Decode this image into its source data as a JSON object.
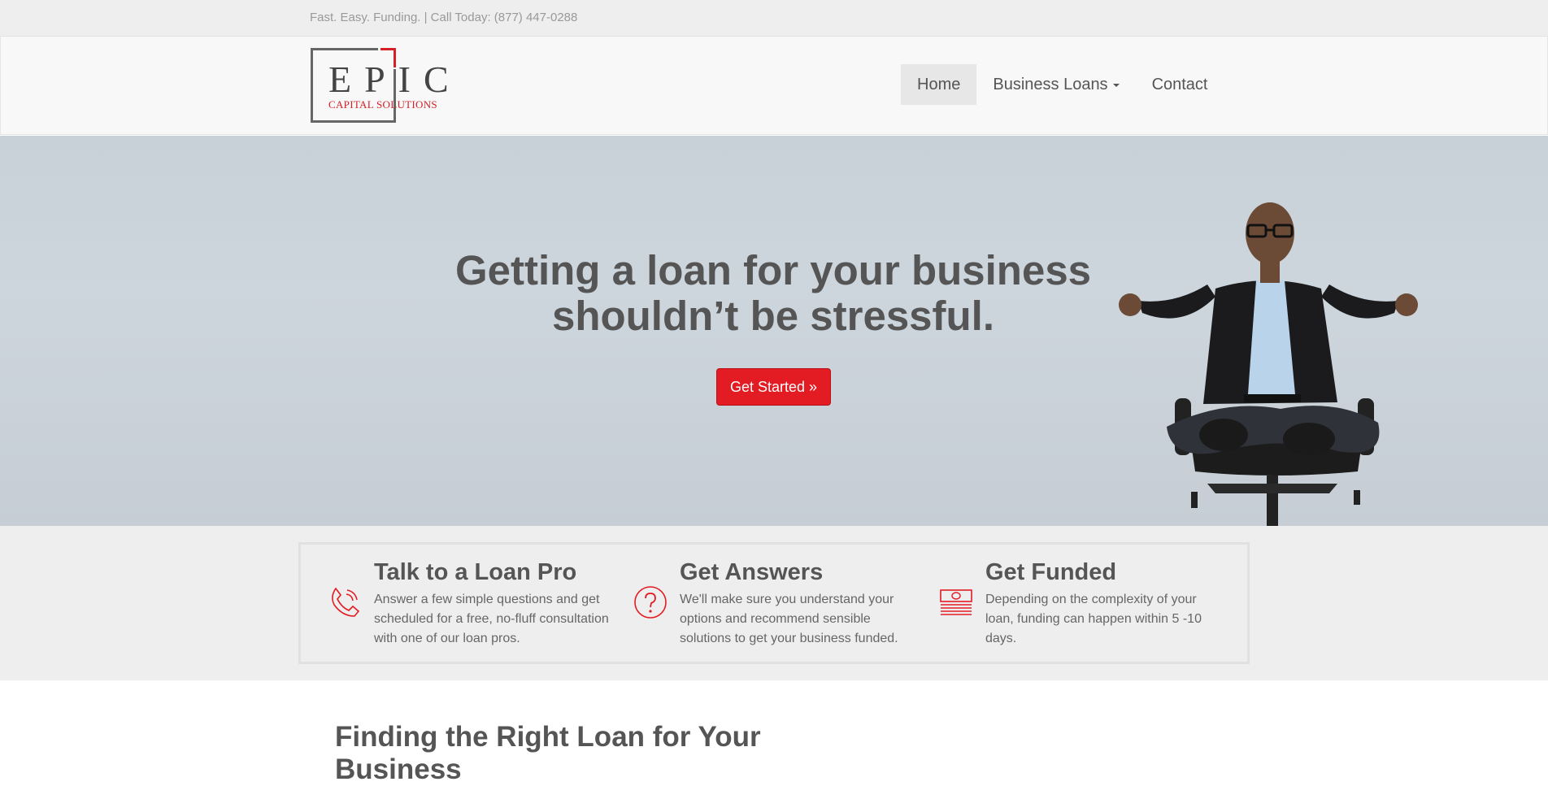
{
  "topbar": {
    "tagline": "Fast. Easy. Funding. | Call Today: (877) 447-0288"
  },
  "logo": {
    "word": "EPIC",
    "sub": "CAPITAL SOLUTIONS"
  },
  "nav": {
    "home": "Home",
    "business_loans": "Business Loans",
    "contact": "Contact"
  },
  "hero": {
    "headline": "Getting a loan for your business shouldn’t be stressful.",
    "cta": "Get Started »"
  },
  "features": [
    {
      "icon": "phone-icon",
      "title": "Talk to a Loan Pro",
      "text": "Answer a few simple questions and get scheduled for a free, no-fluff consultation with one of our loan pros."
    },
    {
      "icon": "question-icon",
      "title": "Get Answers",
      "text": "We'll make sure you understand your options and recommend sensible solutions to get your business funded."
    },
    {
      "icon": "money-icon",
      "title": "Get Funded",
      "text": "Depending on the complexity of your loan, funding can happen within 5 -10 days."
    }
  ],
  "section": {
    "heading": "Finding the Right Loan for Your Business"
  },
  "colors": {
    "accent": "#e31b23",
    "text": "#555555",
    "topbar": "#eeeeee"
  }
}
